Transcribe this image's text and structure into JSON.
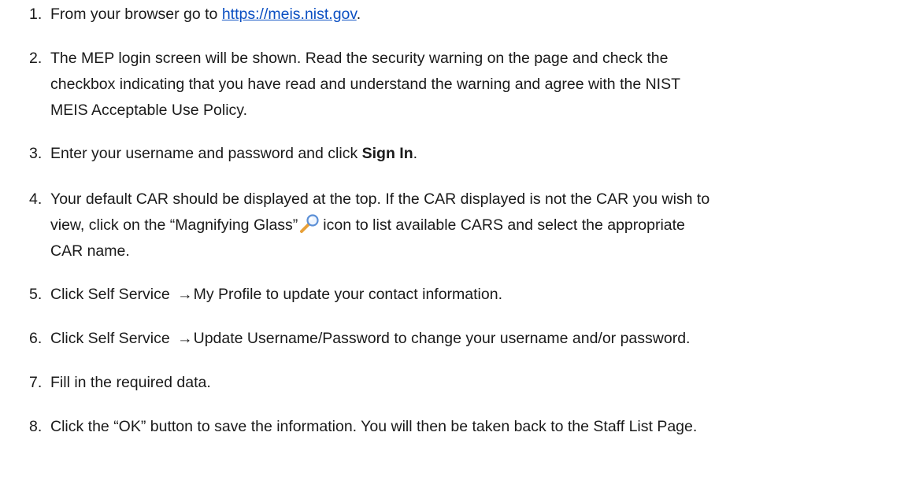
{
  "steps": [
    {
      "num": "1.",
      "pre": "From your browser go to ",
      "link": "https://meis.nist.gov",
      "post": "."
    },
    {
      "num": "2.",
      "lines": [
        "The MEP login screen will be shown. Read the security warning on the page and check the",
        "checkbox indicating that you have read and understand the warning and agree with the NIST",
        "MEIS Acceptable Use Policy."
      ]
    },
    {
      "num": "3.",
      "pre": "Enter your username and password and click ",
      "bold": "Sign In",
      "post": "."
    },
    {
      "num": "4.",
      "line1": "Your default CAR should be displayed at the top. If the CAR displayed is not the CAR you wish to",
      "line2_pre": "view, click on the “Magnifying Glass”",
      "line2_post": "icon to list available CARS and select the appropriate",
      "line3": "CAR name."
    },
    {
      "num": "5.",
      "pre": "Click Self Service ",
      "arrow": "→",
      "post": "My Profile to update your contact information."
    },
    {
      "num": "6.",
      "pre": "Click Self Service ",
      "arrow": "→",
      "post": "Update Username/Password to change your username and/or password."
    },
    {
      "num": "7.",
      "text": "Fill in the required data."
    },
    {
      "num": "8.",
      "text": "Click the “OK” button to save the information. You will then be taken back to the Staff List Page."
    }
  ],
  "icons": {
    "magnifier": "magnifying-glass-icon"
  },
  "colors": {
    "link": "#0b4fc2",
    "text": "#1a1a1a",
    "icon_handle": "#e8a13a",
    "icon_lens": "#5b8fd6"
  }
}
